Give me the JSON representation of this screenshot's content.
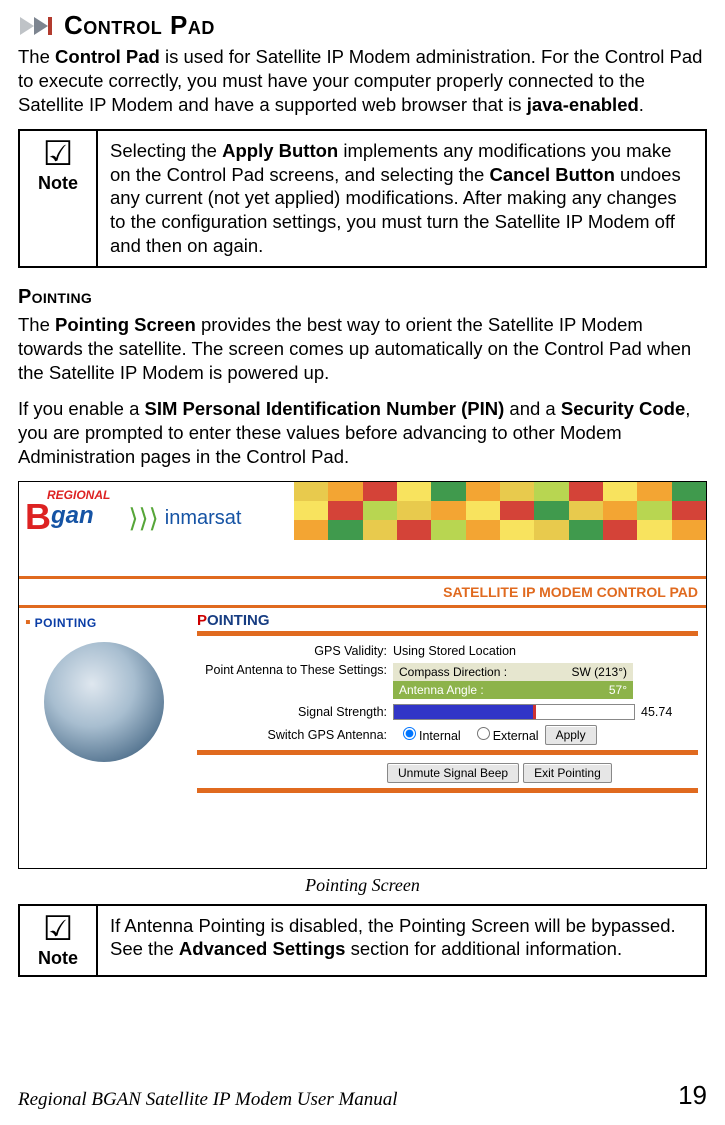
{
  "heading": "Control Pad",
  "intro": {
    "pre": "The ",
    "bold1": "Control Pad",
    "mid": " is used for Satellite IP Modem administration. For the Control Pad to execute correctly, you must have your computer properly connected to the Satellite IP Modem and have a supported web browser that is ",
    "bold2": "java-enabled",
    "post": "."
  },
  "note1": {
    "label": "Note",
    "t1": "Selecting the ",
    "b1": "Apply Button",
    "t2": " implements any modifications you make on the Control Pad screens, and selecting the ",
    "b2": "Cancel Button",
    "t3": " undoes any current (not yet applied) modifications. After making any changes to the configuration settings, you must turn the Satellite IP Modem off and then on again."
  },
  "pointing_heading": "Pointing",
  "pointing_p1": {
    "pre": "The ",
    "b1": "Pointing Screen",
    "post": " provides the best way to orient the Satellite IP Modem towards the satellite. The screen comes up automatically on the Control Pad when the Satellite IP Modem is powered up."
  },
  "pointing_p2": {
    "pre": "If you enable a ",
    "b1": "SIM Personal Identification Number (PIN)",
    "mid": " and a ",
    "b2": "Security Code",
    "post": ", you are prompted to enter these values before advancing to other Modem Administration pages in the Control Pad."
  },
  "screenshot": {
    "title_bar": "SATELLITE IP MODEM CONTROL PAD",
    "sidebar_item": "POINTING",
    "main_heading_first": "P",
    "main_heading_rest": "OINTING",
    "logo_regional": "REGIONAL",
    "logo_b": "B",
    "logo_gan": "gan",
    "logo_inmarsat": "inmarsat",
    "fields": {
      "gps_label": "GPS Validity:",
      "gps_value": "Using Stored Location",
      "point_label": "Point Antenna to These Settings:",
      "compass_key": "Compass Direction :",
      "compass_val": "SW (213°)",
      "angle_key": "Antenna Angle :",
      "angle_val": "57°",
      "signal_label": "Signal Strength:",
      "signal_val": "45.74",
      "switch_label": "Switch GPS Antenna:",
      "radio_internal": "Internal",
      "radio_external": "External",
      "apply_btn": "Apply",
      "unmute_btn": "Unmute Signal Beep",
      "exit_btn": "Exit Pointing"
    }
  },
  "caption": "Pointing Screen",
  "note2": {
    "label": "Note",
    "t1": "If Antenna Pointing is disabled, the Pointing Screen will be bypassed. See the ",
    "b1": "Advanced Settings",
    "t2": " section for additional information."
  },
  "footer_title": "Regional BGAN Satellite IP Modem User Manual",
  "page_num": "19"
}
